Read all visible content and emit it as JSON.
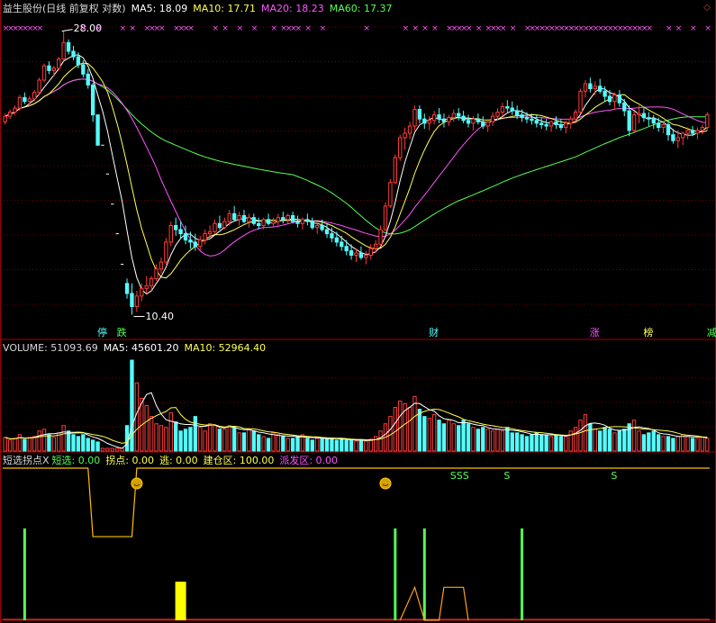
{
  "colors": {
    "up": "#ff3c3c",
    "down": "#54fcfc",
    "ma5": "#ffffff",
    "ma10": "#ffff54",
    "ma20": "#ff54ff",
    "ma60": "#54ff54",
    "grid": "#7a0000",
    "orange": "#ff9f20",
    "marker": "#ff54ff"
  },
  "price_header": {
    "title": "益生股份(日线 前复权 对数)",
    "ma5": "MA5: 18.09",
    "ma10": "MA10: 17.71",
    "ma20": "MA20: 18.23",
    "ma60": "MA60: 17.37",
    "corner_icon": "diamond-icon"
  },
  "price_annotations": {
    "high_label": "28.00",
    "low_label": "10.40"
  },
  "event_tags": [
    {
      "text": "停",
      "color": "#54fcfc",
      "index": 20
    },
    {
      "text": "跌",
      "color": "#54ff54",
      "index": 24
    },
    {
      "text": "财",
      "color": "#54fcfc",
      "index": 88
    },
    {
      "text": "涨",
      "color": "#ff54ff",
      "index": 121
    },
    {
      "text": "榜",
      "color": "#ffff54",
      "index": 132
    },
    {
      "text": "减",
      "color": "#54ff54",
      "index": 145
    }
  ],
  "volume_header": {
    "volume": "VOLUME: 51093.69",
    "ma5": "MA5: 45601.20",
    "ma10": "MA10: 52964.40"
  },
  "indicator_header": {
    "name": "短选拐点X",
    "duanxuan": "短选: 0.00",
    "guaidian": "拐点: 0.00",
    "tao": "逃: 0.00",
    "jiancang": "建仓区: 100.00",
    "paifa": "派发区: 0.00"
  },
  "indicator_signals": [
    {
      "text": "SSS",
      "index": 92
    },
    {
      "text": "S",
      "index": 103
    },
    {
      "text": "S",
      "index": 125
    }
  ],
  "chart_data": {
    "type": "candlestick",
    "scale": "log",
    "ylim": [
      10.0,
      29.5
    ],
    "grid": true,
    "candles": [
      [
        20.4,
        21.0,
        20.2,
        20.8
      ],
      [
        20.8,
        21.3,
        20.6,
        21.1
      ],
      [
        21.1,
        21.6,
        20.9,
        21.4
      ],
      [
        21.4,
        22.4,
        21.2,
        22.2
      ],
      [
        22.2,
        22.6,
        21.7,
        21.9
      ],
      [
        21.9,
        22.3,
        21.5,
        22.1
      ],
      [
        22.1,
        22.8,
        21.9,
        22.6
      ],
      [
        22.6,
        23.8,
        22.4,
        23.6
      ],
      [
        23.6,
        25.0,
        23.4,
        24.8
      ],
      [
        24.8,
        25.2,
        24.1,
        24.4
      ],
      [
        24.4,
        24.8,
        23.9,
        24.6
      ],
      [
        24.6,
        25.6,
        24.4,
        25.4
      ],
      [
        25.4,
        28.0,
        25.2,
        26.9
      ],
      [
        26.9,
        27.2,
        25.8,
        26.1
      ],
      [
        26.1,
        26.6,
        25.3,
        25.6
      ],
      [
        25.6,
        26.0,
        24.6,
        24.9
      ],
      [
        24.9,
        25.3,
        23.8,
        24.1
      ],
      [
        24.1,
        24.5,
        22.9,
        23.2
      ],
      [
        23.2,
        23.4,
        20.4,
        20.9
      ],
      [
        20.9,
        20.9,
        18.8,
        18.8
      ],
      [
        18.8,
        18.8,
        18.8,
        18.8
      ],
      [
        17.0,
        17.0,
        17.0,
        17.0
      ],
      [
        15.3,
        15.3,
        15.3,
        15.3
      ],
      [
        13.8,
        13.8,
        13.8,
        13.8
      ],
      [
        12.4,
        12.4,
        12.4,
        12.4
      ],
      [
        11.6,
        11.8,
        11.0,
        11.2
      ],
      [
        11.2,
        11.6,
        10.4,
        10.7
      ],
      [
        10.7,
        11.3,
        10.5,
        11.1
      ],
      [
        11.1,
        11.6,
        10.9,
        11.4
      ],
      [
        11.4,
        11.9,
        11.2,
        11.5
      ],
      [
        11.5,
        11.9,
        11.3,
        11.8
      ],
      [
        11.8,
        12.4,
        11.7,
        12.2
      ],
      [
        12.2,
        12.7,
        12.0,
        12.5
      ],
      [
        12.5,
        13.6,
        12.4,
        13.4
      ],
      [
        13.4,
        14.4,
        13.2,
        14.2
      ],
      [
        14.2,
        14.6,
        13.7,
        14.0
      ],
      [
        14.0,
        14.4,
        13.6,
        13.8
      ],
      [
        13.8,
        14.2,
        13.3,
        13.5
      ],
      [
        13.5,
        13.9,
        13.1,
        13.4
      ],
      [
        13.4,
        13.8,
        13.0,
        13.2
      ],
      [
        13.2,
        13.7,
        13.0,
        13.5
      ],
      [
        13.5,
        14.0,
        13.3,
        13.8
      ],
      [
        13.8,
        14.2,
        13.6,
        13.9
      ],
      [
        13.9,
        14.5,
        13.8,
        14.3
      ],
      [
        14.3,
        14.7,
        14.0,
        14.1
      ],
      [
        14.1,
        14.6,
        14.0,
        14.4
      ],
      [
        14.4,
        15.0,
        14.2,
        14.8
      ],
      [
        14.8,
        15.2,
        14.4,
        14.5
      ],
      [
        14.5,
        14.9,
        14.2,
        14.7
      ],
      [
        14.7,
        15.0,
        14.3,
        14.4
      ],
      [
        14.4,
        14.8,
        14.1,
        14.6
      ],
      [
        14.6,
        14.8,
        14.2,
        14.3
      ],
      [
        14.3,
        14.6,
        14.0,
        14.2
      ],
      [
        14.2,
        14.6,
        14.0,
        14.5
      ],
      [
        14.5,
        14.8,
        14.2,
        14.3
      ],
      [
        14.3,
        14.6,
        14.1,
        14.4
      ],
      [
        14.4,
        14.8,
        14.2,
        14.6
      ],
      [
        14.6,
        14.9,
        14.3,
        14.5
      ],
      [
        14.5,
        14.8,
        14.3,
        14.7
      ],
      [
        14.7,
        14.9,
        14.3,
        14.4
      ],
      [
        14.4,
        14.7,
        14.1,
        14.3
      ],
      [
        14.3,
        14.6,
        14.0,
        14.5
      ],
      [
        14.5,
        14.8,
        14.2,
        14.4
      ],
      [
        14.4,
        14.6,
        14.0,
        14.1
      ],
      [
        14.1,
        14.4,
        13.8,
        14.2
      ],
      [
        14.2,
        14.5,
        13.9,
        14.0
      ],
      [
        14.0,
        14.3,
        13.6,
        13.8
      ],
      [
        13.8,
        14.1,
        13.4,
        13.6
      ],
      [
        13.6,
        13.9,
        13.2,
        13.4
      ],
      [
        13.4,
        13.7,
        13.0,
        13.2
      ],
      [
        13.2,
        13.5,
        12.8,
        13.0
      ],
      [
        13.0,
        13.3,
        12.6,
        12.8
      ],
      [
        12.8,
        13.1,
        12.5,
        12.9
      ],
      [
        12.9,
        13.2,
        12.6,
        12.7
      ],
      [
        12.7,
        13.0,
        12.4,
        12.8
      ],
      [
        12.8,
        13.3,
        12.6,
        13.1
      ],
      [
        13.1,
        13.5,
        12.9,
        13.3
      ],
      [
        13.3,
        14.2,
        13.2,
        14.0
      ],
      [
        14.0,
        15.4,
        13.9,
        15.2
      ],
      [
        15.2,
        16.7,
        15.1,
        16.5
      ],
      [
        16.5,
        18.2,
        16.4,
        18.0
      ],
      [
        18.0,
        19.5,
        17.8,
        19.3
      ],
      [
        19.3,
        20.0,
        18.5,
        19.6
      ],
      [
        19.6,
        20.4,
        19.2,
        20.1
      ],
      [
        20.1,
        21.6,
        19.8,
        21.3
      ],
      [
        21.3,
        21.6,
        20.3,
        20.6
      ],
      [
        20.6,
        21.0,
        19.9,
        20.3
      ],
      [
        20.3,
        20.8,
        19.8,
        20.5
      ],
      [
        20.5,
        21.2,
        20.2,
        20.9
      ],
      [
        20.9,
        21.4,
        20.3,
        20.6
      ],
      [
        20.6,
        21.0,
        20.0,
        20.4
      ],
      [
        20.4,
        20.9,
        20.1,
        20.7
      ],
      [
        20.7,
        21.3,
        20.4,
        21.0
      ],
      [
        21.0,
        21.4,
        20.5,
        20.8
      ],
      [
        20.8,
        21.2,
        20.3,
        20.5
      ],
      [
        20.5,
        20.9,
        20.0,
        20.3
      ],
      [
        20.3,
        20.8,
        19.8,
        20.6
      ],
      [
        20.6,
        21.0,
        20.2,
        20.4
      ],
      [
        20.4,
        20.8,
        19.9,
        20.1
      ],
      [
        20.1,
        20.6,
        19.7,
        20.4
      ],
      [
        20.4,
        21.1,
        20.1,
        20.8
      ],
      [
        20.8,
        21.4,
        20.5,
        21.1
      ],
      [
        21.1,
        21.8,
        20.8,
        21.5
      ],
      [
        21.5,
        22.0,
        21.1,
        21.4
      ],
      [
        21.4,
        21.9,
        20.9,
        21.2
      ],
      [
        21.2,
        21.6,
        20.6,
        20.9
      ],
      [
        20.9,
        21.3,
        20.4,
        20.7
      ],
      [
        20.7,
        21.1,
        20.3,
        20.6
      ],
      [
        20.6,
        21.0,
        20.2,
        20.5
      ],
      [
        20.5,
        20.9,
        20.0,
        20.3
      ],
      [
        20.3,
        20.7,
        19.9,
        20.2
      ],
      [
        20.2,
        20.6,
        19.8,
        20.1
      ],
      [
        20.1,
        20.5,
        19.7,
        20.4
      ],
      [
        20.4,
        20.8,
        19.9,
        20.2
      ],
      [
        20.2,
        20.6,
        19.8,
        20.0
      ],
      [
        20.0,
        20.5,
        19.6,
        20.3
      ],
      [
        20.3,
        20.8,
        19.9,
        20.6
      ],
      [
        20.6,
        21.3,
        20.3,
        21.1
      ],
      [
        21.1,
        22.9,
        21.0,
        22.7
      ],
      [
        22.7,
        23.6,
        22.2,
        23.3
      ],
      [
        23.3,
        23.8,
        22.6,
        22.9
      ],
      [
        22.9,
        23.5,
        22.4,
        23.1
      ],
      [
        23.1,
        23.7,
        22.5,
        22.7
      ],
      [
        22.7,
        23.1,
        21.9,
        22.3
      ],
      [
        22.3,
        22.8,
        21.6,
        21.9
      ],
      [
        21.9,
        22.6,
        21.3,
        22.4
      ],
      [
        22.4,
        22.8,
        21.5,
        21.8
      ],
      [
        21.8,
        22.1,
        20.8,
        21.2
      ],
      [
        21.2,
        21.6,
        19.4,
        19.8
      ],
      [
        19.8,
        21.2,
        19.6,
        20.9
      ],
      [
        20.9,
        21.6,
        20.3,
        21.0
      ],
      [
        21.0,
        21.4,
        20.4,
        20.7
      ],
      [
        20.7,
        21.1,
        20.1,
        20.6
      ],
      [
        20.6,
        20.9,
        19.9,
        20.3
      ],
      [
        20.3,
        20.7,
        19.7,
        20.0
      ],
      [
        20.0,
        20.4,
        19.6,
        20.2
      ],
      [
        20.2,
        20.5,
        19.1,
        19.5
      ],
      [
        19.5,
        19.9,
        18.9,
        19.1
      ],
      [
        19.1,
        19.8,
        18.6,
        19.3
      ],
      [
        19.3,
        19.7,
        18.8,
        19.6
      ],
      [
        19.6,
        20.0,
        19.2,
        19.8
      ],
      [
        19.8,
        20.1,
        19.4,
        19.6
      ],
      [
        19.6,
        20.0,
        19.2,
        19.8
      ],
      [
        19.8,
        20.2,
        19.5,
        20.0
      ],
      [
        20.0,
        21.1,
        19.8,
        20.9
      ]
    ],
    "volume": {
      "ylim": [
        0,
        105
      ],
      "values": [
        15,
        12,
        14,
        18,
        13,
        15,
        16,
        22,
        24,
        18,
        15,
        20,
        28,
        22,
        18,
        16,
        18,
        14,
        12,
        10,
        3,
        3,
        3,
        3,
        3,
        28,
        100,
        75,
        58,
        50,
        38,
        30,
        28,
        26,
        42,
        32,
        22,
        24,
        26,
        38,
        26,
        22,
        30,
        28,
        24,
        24,
        28,
        26,
        20,
        20,
        24,
        22,
        18,
        16,
        14,
        20,
        18,
        16,
        14,
        14,
        16,
        18,
        14,
        12,
        14,
        14,
        14,
        14,
        12,
        13,
        12,
        12,
        11,
        12,
        11,
        13,
        16,
        22,
        30,
        38,
        48,
        55,
        52,
        48,
        60,
        46,
        38,
        36,
        40,
        34,
        30,
        34,
        30,
        28,
        34,
        30,
        26,
        24,
        26,
        24,
        22,
        24,
        22,
        26,
        20,
        20,
        18,
        16,
        18,
        20,
        18,
        17,
        16,
        18,
        16,
        16,
        22,
        26,
        34,
        40,
        30,
        24,
        22,
        26,
        24,
        20,
        22,
        24,
        30,
        34,
        22,
        18,
        20,
        22,
        18,
        16,
        16,
        14,
        16,
        18,
        16,
        14,
        14,
        15,
        14,
        15,
        16
      ],
      "ma5": [],
      "ma10": []
    },
    "indicator": {
      "jiancang_level": 100,
      "jiancang_dip": {
        "from": 17,
        "to": 27,
        "level": 55
      },
      "green_bars": [
        {
          "index": 4,
          "value": 100
        },
        {
          "index": 80,
          "value": 100
        },
        {
          "index": 86,
          "value": 100
        },
        {
          "index": 106,
          "value": 100
        }
      ],
      "yellow_bars": [
        {
          "index": 36,
          "value": 42
        }
      ],
      "orange_segments": [
        [
          81,
          0
        ],
        [
          84,
          36
        ],
        [
          86,
          0
        ],
        [
          89,
          0
        ],
        [
          90,
          36
        ],
        [
          94,
          36
        ],
        [
          95,
          0
        ]
      ],
      "smile_markers": [
        27,
        78
      ]
    },
    "ma_periods": [
      5,
      10,
      20,
      60
    ]
  }
}
